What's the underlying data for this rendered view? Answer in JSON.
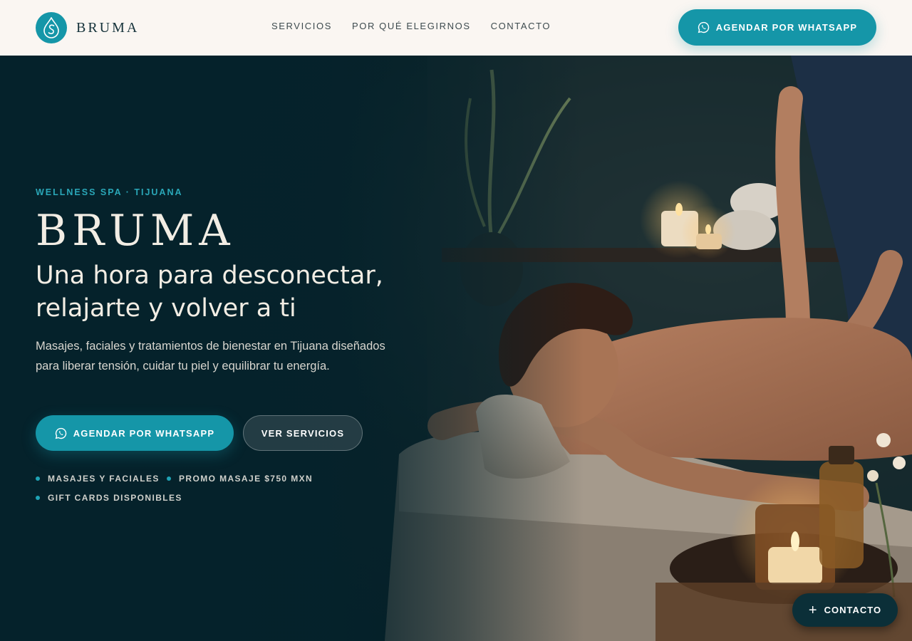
{
  "brand": {
    "name": "BRUMA",
    "logo_icon": "water-drop-s-icon",
    "accent": "#1596a8"
  },
  "nav": {
    "items": [
      "SERVICIOS",
      "POR QUÉ ELEGIRNOS",
      "CONTACTO"
    ]
  },
  "header": {
    "cta_label": "AGENDAR POR WHATSAPP",
    "cta_icon": "whatsapp-icon"
  },
  "hero": {
    "eyebrow": "WELLNESS SPA · TIJUANA",
    "title": "BRUMA",
    "subtitle_line1": "Una hora para desconectar,",
    "subtitle_line2": "relajarte y volver a ti",
    "description": "Masajes, faciales y tratamientos de bienestar en Tijuana diseñados para liberar tensión, cuidar tu piel y equilibrar tu energía.",
    "primary_cta": "AGENDAR POR WHATSAPP",
    "secondary_cta": "VER SERVICIOS",
    "features": [
      "MASAJES Y FACIALES",
      "PROMO MASAJE $750 MXN",
      "GIFT CARDS DISPONIBLES"
    ],
    "background_image": "spa-massage-photo"
  },
  "floating": {
    "contact_label": "CONTACTO",
    "icon": "plus-icon"
  },
  "colors": {
    "header_bg": "#faf6f2",
    "hero_bg": "#05222b",
    "accent": "#1596a8",
    "fab_bg": "#0b2f38"
  }
}
